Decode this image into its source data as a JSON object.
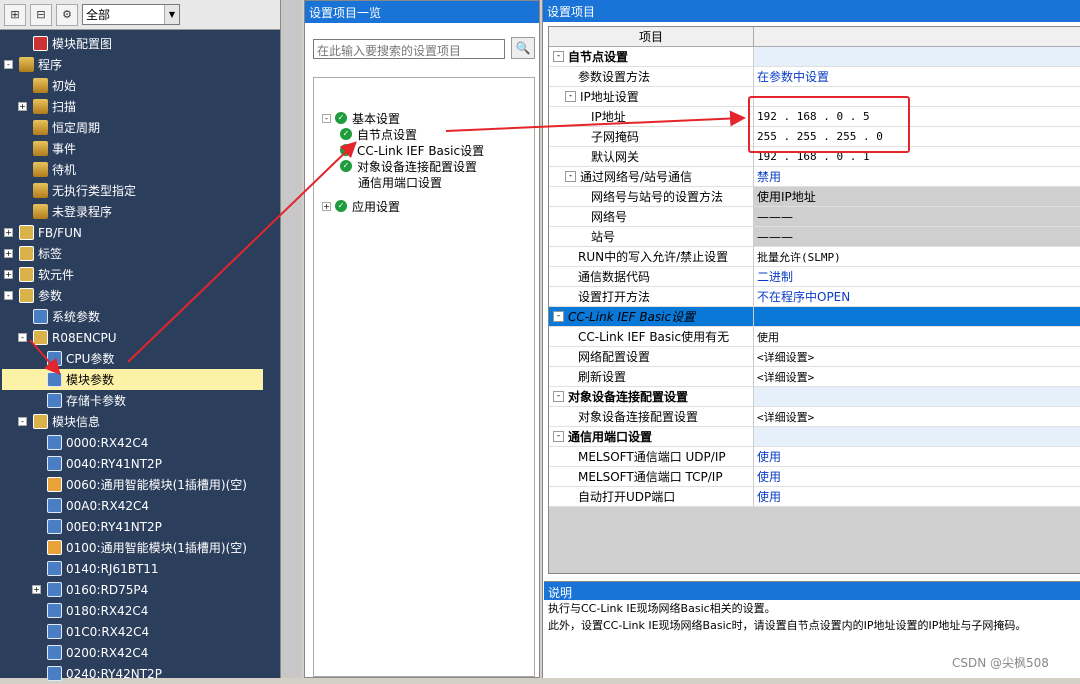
{
  "toolbar": {
    "combo_value": "全部",
    "arrow": "▼"
  },
  "left_tree": [
    {
      "label": "模块配置图",
      "icon": "config-icon",
      "expand": ""
    },
    {
      "label": "程序",
      "icon": "program-icon",
      "expand": "-"
    },
    {
      "label": "初始",
      "icon": "program-icon",
      "expand": ""
    },
    {
      "label": "扫描",
      "icon": "program-icon",
      "expand": "+"
    },
    {
      "label": "恒定周期",
      "icon": "program-icon",
      "expand": ""
    },
    {
      "label": "事件",
      "icon": "program-icon",
      "expand": ""
    },
    {
      "label": "待机",
      "icon": "program-icon",
      "expand": ""
    },
    {
      "label": "无执行类型指定",
      "icon": "program-icon",
      "expand": ""
    },
    {
      "label": "未登录程序",
      "icon": "program-icon",
      "expand": ""
    },
    {
      "label": "FB/FUN",
      "icon": "group-icon",
      "expand": "+"
    },
    {
      "label": "标签",
      "icon": "group-icon",
      "expand": "+"
    },
    {
      "label": "软元件",
      "icon": "group-icon",
      "expand": "+"
    },
    {
      "label": "参数",
      "icon": "group-icon",
      "expand": "-"
    },
    {
      "label": "系统参数",
      "icon": "parameter-icon",
      "expand": ""
    },
    {
      "label": "R08ENCPU",
      "icon": "group-icon",
      "expand": "-"
    },
    {
      "label": "CPU参数",
      "icon": "parameter-icon",
      "expand": ""
    },
    {
      "label": "模块参数",
      "icon": "parameter-icon",
      "expand": ""
    },
    {
      "label": "存储卡参数",
      "icon": "parameter-icon",
      "expand": ""
    },
    {
      "label": "模块信息",
      "icon": "group-icon",
      "expand": "-"
    },
    {
      "label": "0000:RX42C4",
      "icon": "parameter-icon",
      "expand": ""
    },
    {
      "label": "0040:RY41NT2P",
      "icon": "parameter-icon",
      "expand": ""
    },
    {
      "label": "0060:通用智能模块(1插槽用)(空)",
      "icon": "module-icon",
      "expand": ""
    },
    {
      "label": "00A0:RX42C4",
      "icon": "parameter-icon",
      "expand": ""
    },
    {
      "label": "00E0:RY41NT2P",
      "icon": "parameter-icon",
      "expand": ""
    },
    {
      "label": "0100:通用智能模块(1插槽用)(空)",
      "icon": "module-icon",
      "expand": ""
    },
    {
      "label": "0140:RJ61BT11",
      "icon": "parameter-icon",
      "expand": ""
    },
    {
      "label": "0160:RD75P4",
      "icon": "parameter-icon",
      "expand": "+"
    },
    {
      "label": "0180:RX42C4",
      "icon": "parameter-icon",
      "expand": ""
    },
    {
      "label": "01C0:RX42C4",
      "icon": "parameter-icon",
      "expand": ""
    },
    {
      "label": "0200:RX42C4",
      "icon": "parameter-icon",
      "expand": ""
    },
    {
      "label": "0240:RY42NT2P",
      "icon": "parameter-icon",
      "expand": ""
    }
  ],
  "mid": {
    "title": "设置项目一览",
    "search_placeholder": "在此输入要搜索的设置项目",
    "tree": [
      {
        "label": "基本设置",
        "expand": "-",
        "check": true
      },
      {
        "label": "自节点设置",
        "expand": "",
        "check": true
      },
      {
        "label": "CC-Link IEF Basic设置",
        "expand": "",
        "check": true
      },
      {
        "label": "对象设备连接配置设置",
        "expand": "",
        "check": true
      },
      {
        "label": "通信用端口设置",
        "expand": "",
        "check": false
      },
      {
        "label": "应用设置",
        "expand": "+",
        "check": true
      }
    ]
  },
  "right": {
    "title": "设置项目",
    "col_header": "项目",
    "rows": [
      {
        "item": "自节点设置",
        "value": "",
        "type": "cat",
        "indent": 0
      },
      {
        "item": "参数设置方法",
        "value": "在参数中设置",
        "type": "blue",
        "indent": 1
      },
      {
        "item": "IP地址设置",
        "value": "",
        "type": "sub",
        "indent": 1
      },
      {
        "item": "IP地址",
        "value": "192 . 168 .   0 .   5",
        "type": "plain",
        "indent": 2
      },
      {
        "item": "子网掩码",
        "value": "255 . 255 . 255 .   0",
        "type": "plain",
        "indent": 2
      },
      {
        "item": "默认网关",
        "value": "192 . 168 .   0 .   1",
        "type": "plain",
        "indent": 2
      },
      {
        "item": "通过网络号/站号通信",
        "value": "禁用",
        "type": "subblue",
        "indent": 1
      },
      {
        "item": "网络号与站号的设置方法",
        "value": "使用IP地址",
        "type": "grey",
        "indent": 2
      },
      {
        "item": "网络号",
        "value": "———",
        "type": "grey",
        "indent": 2
      },
      {
        "item": "站号",
        "value": "———",
        "type": "grey",
        "indent": 2
      },
      {
        "item": "RUN中的写入允许/禁止设置",
        "value": "批量允许(SLMP)",
        "type": "plain",
        "indent": 1
      },
      {
        "item": "通信数据代码",
        "value": "二进制",
        "type": "blue",
        "indent": 1
      },
      {
        "item": "设置打开方法",
        "value": "不在程序中OPEN",
        "type": "blue",
        "indent": 1
      },
      {
        "item": "CC-Link IEF Basic设置",
        "value": "",
        "type": "hl",
        "indent": 0
      },
      {
        "item": "CC-Link IEF Basic使用有无",
        "value": "使用",
        "type": "plain",
        "indent": 1
      },
      {
        "item": "网络配置设置",
        "value": "<详细设置>",
        "type": "plain",
        "indent": 1
      },
      {
        "item": "刷新设置",
        "value": "<详细设置>",
        "type": "plain",
        "indent": 1
      },
      {
        "item": "对象设备连接配置设置",
        "value": "",
        "type": "cat",
        "indent": 0
      },
      {
        "item": "对象设备连接配置设置",
        "value": "<详细设置>",
        "type": "plain",
        "indent": 1
      },
      {
        "item": "通信用端口设置",
        "value": "",
        "type": "cat",
        "indent": 0
      },
      {
        "item": "MELSOFT通信端口 UDP/IP",
        "value": "使用",
        "type": "blue",
        "indent": 1
      },
      {
        "item": "MELSOFT通信端口 TCP/IP",
        "value": "使用",
        "type": "blue",
        "indent": 1
      },
      {
        "item": "自动打开UDP端口",
        "value": "使用",
        "type": "blue",
        "indent": 1
      }
    ],
    "desc_title": "说明",
    "desc_lines": [
      "执行与CC-Link IE现场网络Basic相关的设置。",
      "此外，设置CC-Link IE现场网络Basic时，请设置自节点设置内的IP地址设置的IP地址与子网掩码。"
    ]
  },
  "watermark": "CSDN @尖枫508",
  "colors": {
    "accent": "#1a73d6",
    "annotation": "#e4252b",
    "tree_bg": "#2b3e5c"
  }
}
